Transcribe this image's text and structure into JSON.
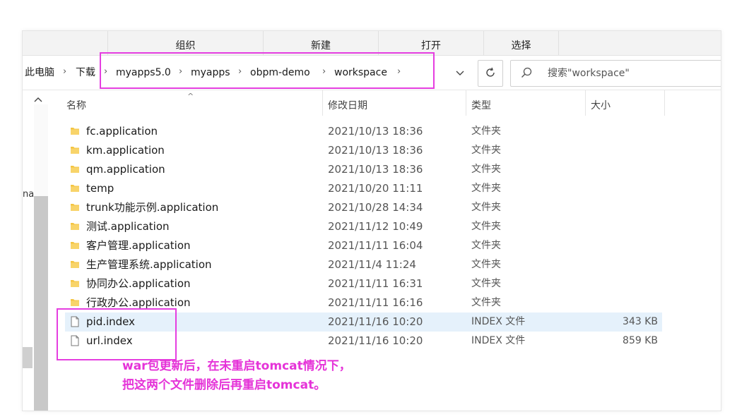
{
  "ribbon": {
    "tabs": [
      "组织",
      "新建",
      "打开",
      "选择"
    ]
  },
  "address": {
    "segments": [
      "此电脑",
      "下载",
      "myapps5.0",
      "myapps",
      "obpm-demo",
      "workspace"
    ]
  },
  "search": {
    "placeholder": "搜索\"workspace\""
  },
  "nav": {
    "partial_text": "na"
  },
  "columns": {
    "name": "名称",
    "modified": "修改日期",
    "type": "类型",
    "size": "大小"
  },
  "files": [
    {
      "name": "fc.application",
      "date": "2021/10/13 18:36",
      "type": "文件夹",
      "size": "",
      "icon": "folder-icon"
    },
    {
      "name": "km.application",
      "date": "2021/10/13 18:36",
      "type": "文件夹",
      "size": "",
      "icon": "folder-icon"
    },
    {
      "name": "qm.application",
      "date": "2021/10/13 18:36",
      "type": "文件夹",
      "size": "",
      "icon": "folder-icon"
    },
    {
      "name": "temp",
      "date": "2021/10/20 11:11",
      "type": "文件夹",
      "size": "",
      "icon": "folder-icon"
    },
    {
      "name": "trunk功能示例.application",
      "date": "2021/10/28 14:34",
      "type": "文件夹",
      "size": "",
      "icon": "folder-icon"
    },
    {
      "name": "测试.application",
      "date": "2021/11/12 10:49",
      "type": "文件夹",
      "size": "",
      "icon": "folder-icon"
    },
    {
      "name": "客户管理.application",
      "date": "2021/11/11 16:04",
      "type": "文件夹",
      "size": "",
      "icon": "folder-icon"
    },
    {
      "name": "生产管理系统.application",
      "date": "2021/11/4 11:24",
      "type": "文件夹",
      "size": "",
      "icon": "folder-icon"
    },
    {
      "name": "协同办公.application",
      "date": "2021/11/11 16:31",
      "type": "文件夹",
      "size": "",
      "icon": "folder-icon"
    },
    {
      "name": "行政办公.application",
      "date": "2021/11/11 16:16",
      "type": "文件夹",
      "size": "",
      "icon": "folder-icon"
    },
    {
      "name": "pid.index",
      "date": "2021/11/16 10:20",
      "type": "INDEX 文件",
      "size": "343 KB",
      "icon": "file-icon",
      "selected": true
    },
    {
      "name": "url.index",
      "date": "2021/11/16 10:20",
      "type": "INDEX 文件",
      "size": "859 KB",
      "icon": "file-icon"
    }
  ],
  "annotation": {
    "line1": "war包更新后，在未重启tomcat情况下，",
    "line2": "把这两个文件删除后再重启tomcat。",
    "color": "#e533d8"
  },
  "colors": {
    "folder": "#f4c542",
    "selection": "#e5f1fb",
    "highlight": "#e53ee0"
  }
}
